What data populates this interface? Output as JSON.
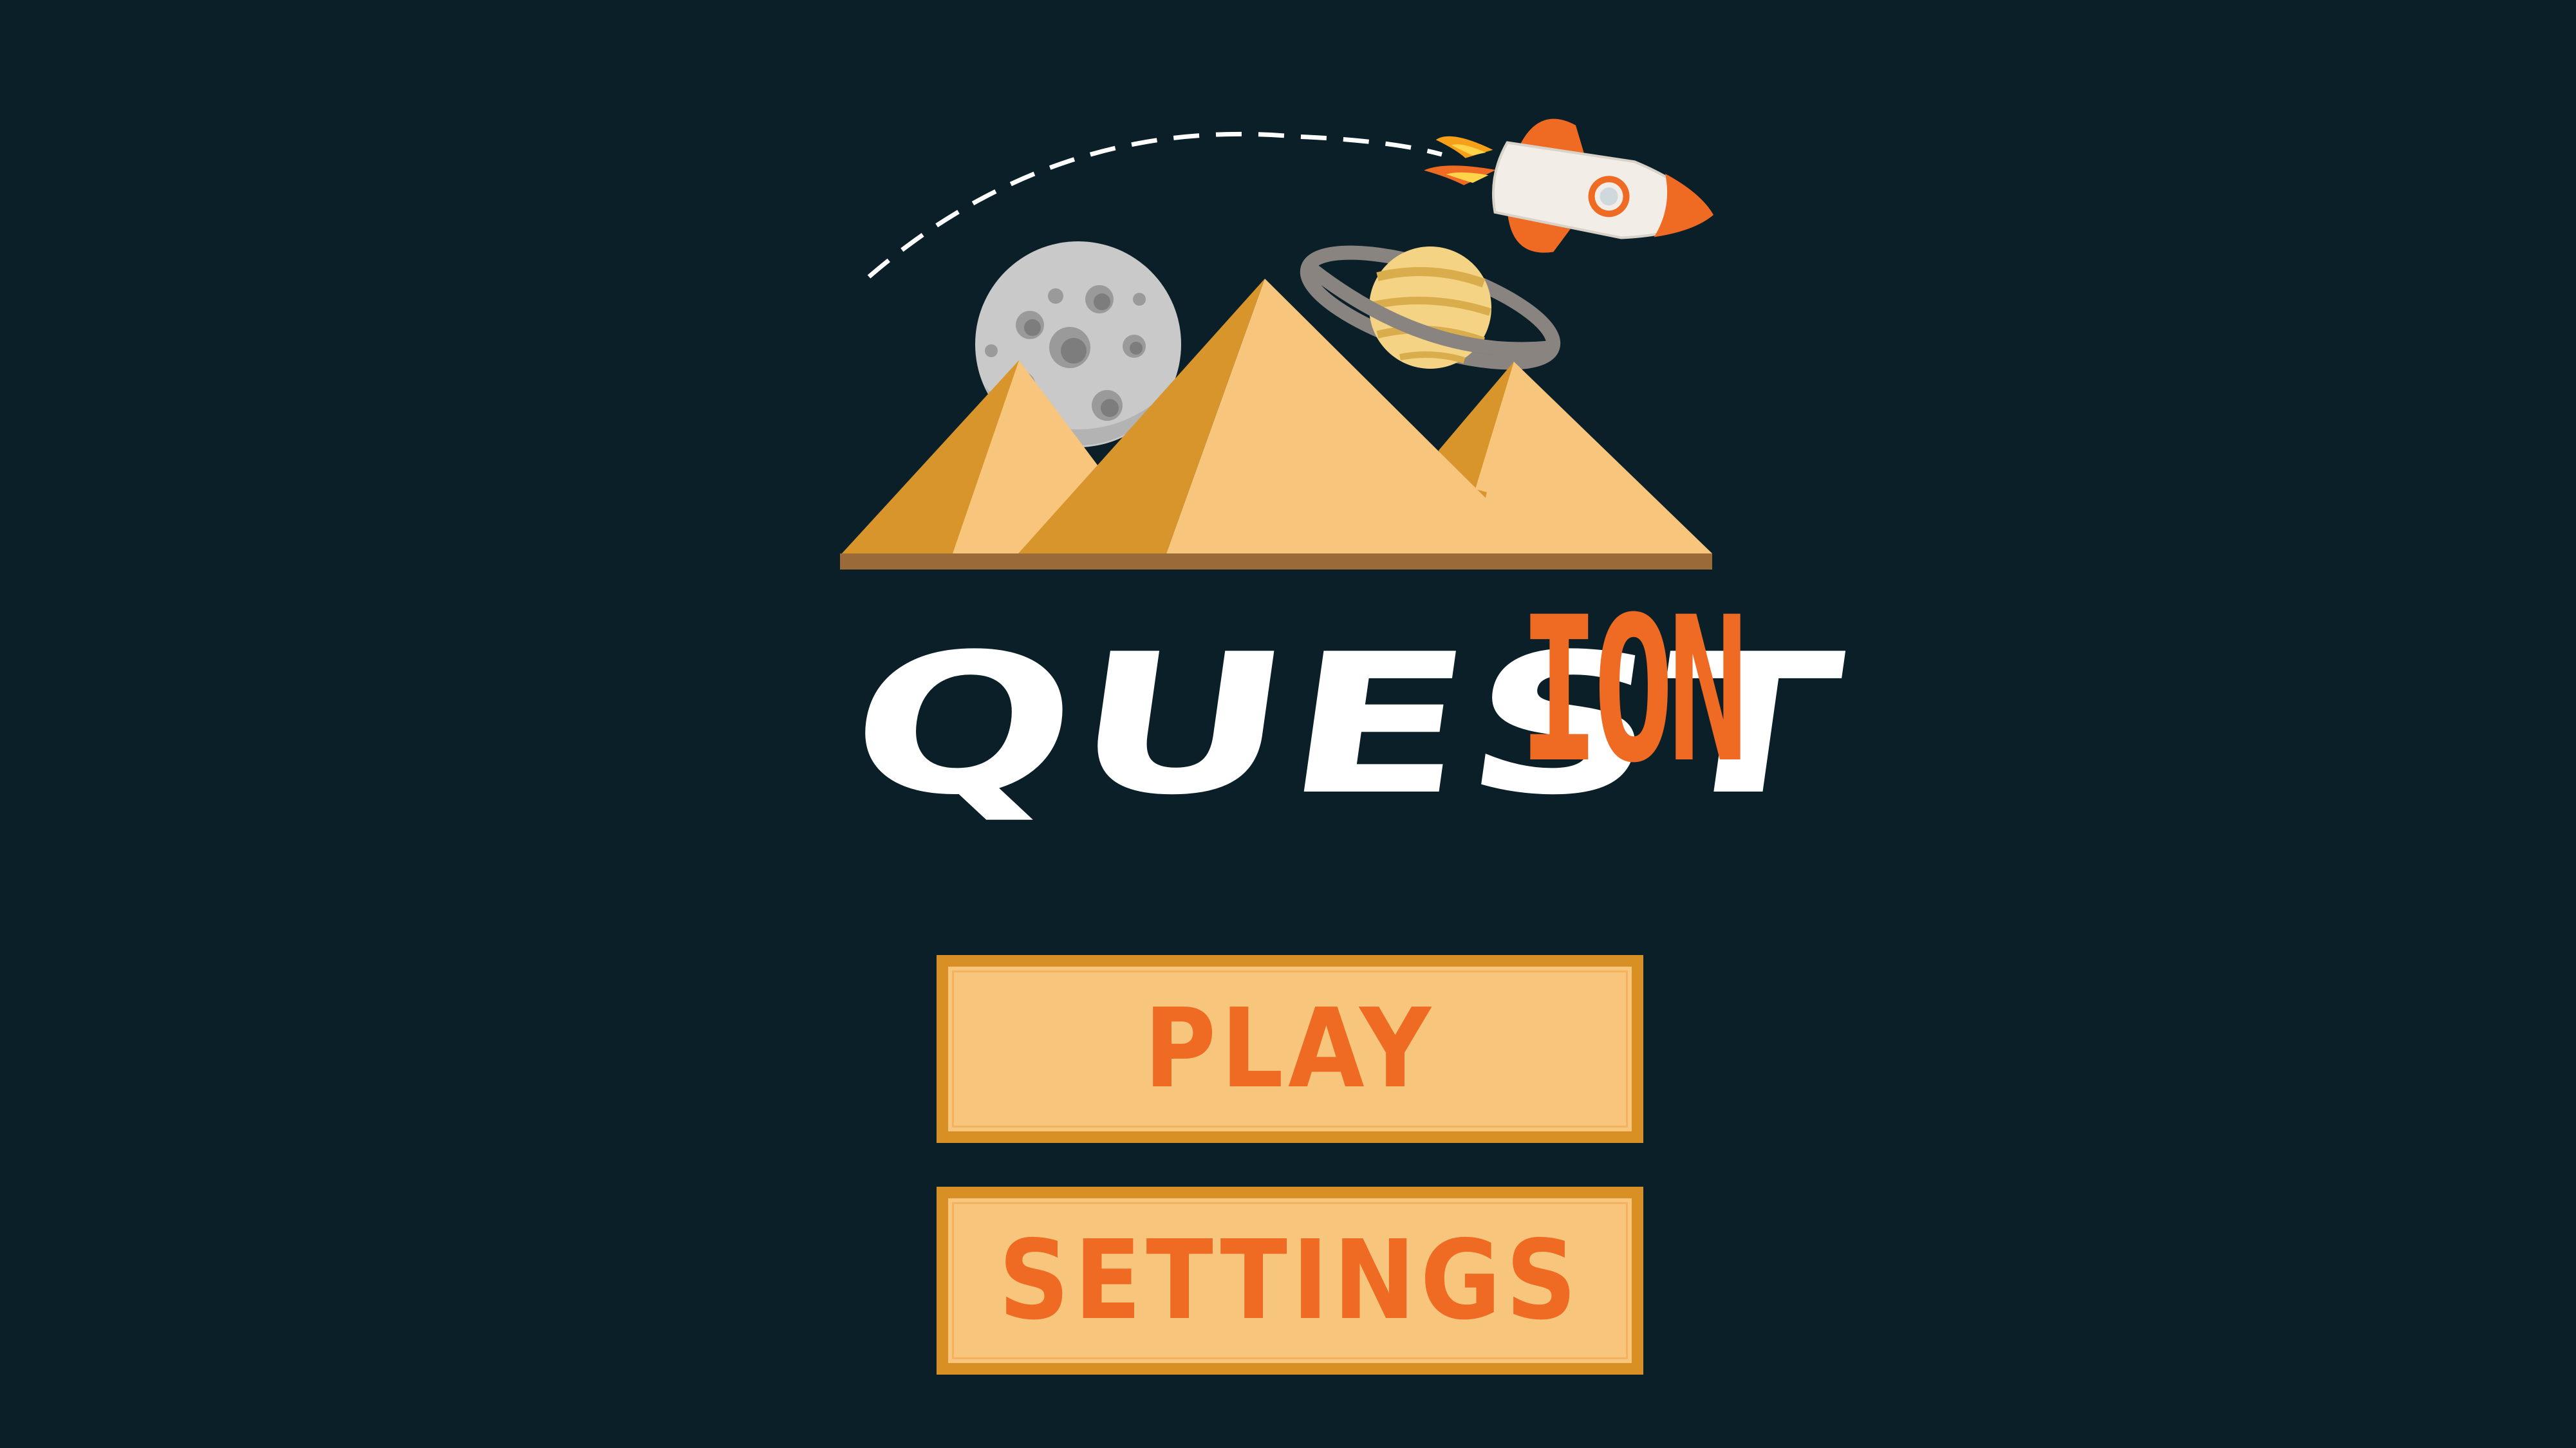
{
  "title": {
    "part1": "QUEST",
    "part2": "ION"
  },
  "colors": {
    "background": "#0a1f28",
    "title_white": "#ffffff",
    "title_orange": "#ef6a22",
    "button_fill": "#f7c57c",
    "button_border": "#d88f24",
    "button_text": "#ef6a22"
  },
  "menu": {
    "play_label": "PLAY",
    "settings_label": "SETTINGS"
  },
  "icons": [
    "rocket-icon",
    "moon-icon",
    "ringed-planet-icon",
    "pyramids-icon"
  ]
}
